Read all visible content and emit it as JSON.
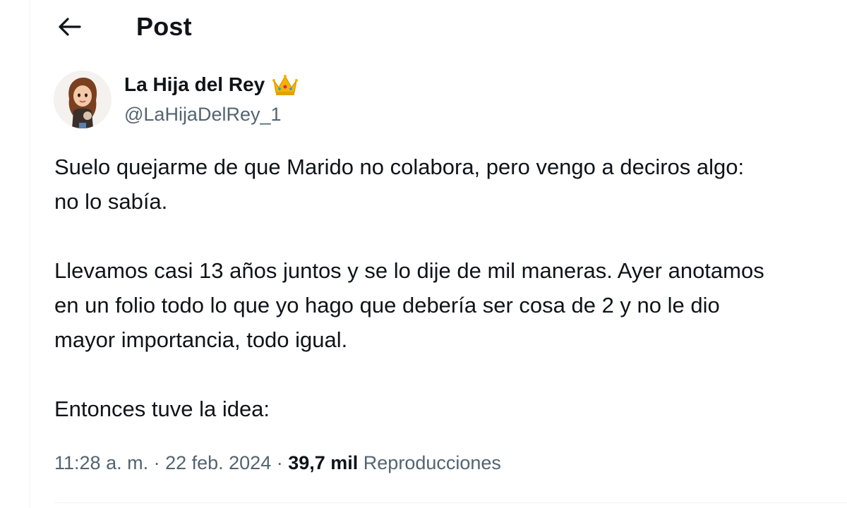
{
  "header": {
    "title": "Post",
    "back_icon": "arrow-left-icon"
  },
  "author": {
    "display_name": "La Hija del Rey",
    "badge_icon": "crown-emoji-icon",
    "handle": "@LaHijaDelRey_1"
  },
  "post": {
    "paragraphs": [
      [
        "Suelo quejarme de que Marido no colabora, pero vengo a deciros algo:",
        "no lo sabía."
      ],
      [
        "Llevamos casi 13 años juntos y se lo dije de mil maneras. Ayer anotamos",
        "en un folio todo lo que yo hago que debería ser cosa de 2 y no le dio",
        "mayor importancia, todo igual."
      ],
      [
        "Entonces tuve la idea:"
      ]
    ]
  },
  "meta": {
    "time": "11:28 a. m.",
    "sep1": " · ",
    "date": "22 feb. 2024",
    "sep2": " · ",
    "views_count": "39,7 mil",
    "views_label": "Reproducciones"
  },
  "colors": {
    "text": "#0f1419",
    "secondary": "#536471",
    "border": "#eff3f4",
    "crown": "#f4b400"
  }
}
